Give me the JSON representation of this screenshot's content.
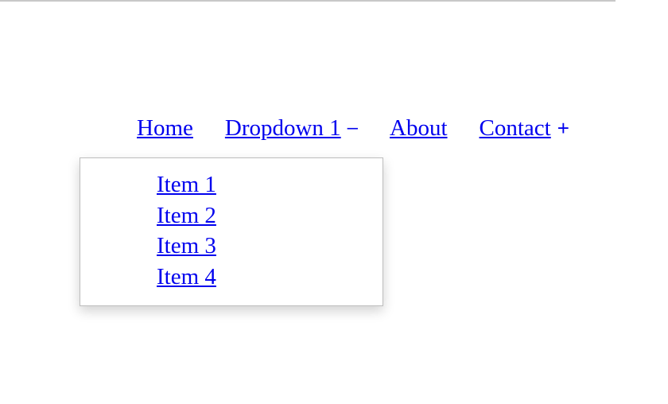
{
  "nav": {
    "home_label": "Home",
    "dropdown_label": "Dropdown 1",
    "dropdown_toggle": "–",
    "about_label": "About",
    "contact_label": "Contact",
    "contact_toggle": "+"
  },
  "dropdown": {
    "items": [
      {
        "label": "Item 1"
      },
      {
        "label": "Item 2"
      },
      {
        "label": "Item 3"
      },
      {
        "label": "Item 4"
      }
    ]
  },
  "colors": {
    "link": "#0000ee",
    "panel_border": "#bdbdbd",
    "top_rule": "#c8c8c8"
  },
  "icons": {
    "dropdown_toggle": "minus-icon",
    "contact_toggle": "plus-icon"
  }
}
